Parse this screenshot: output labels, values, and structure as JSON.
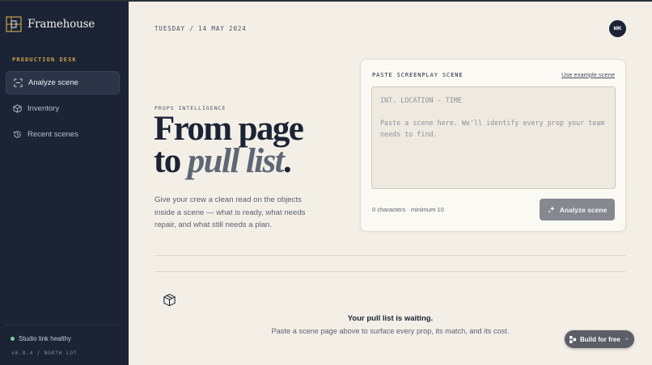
{
  "app": {
    "name": "Framehouse"
  },
  "sidebar": {
    "section_label": "PRODUCTION DESK",
    "items": [
      {
        "label": "Analyze scene",
        "icon": "scan-icon",
        "active": true
      },
      {
        "label": "Inventory",
        "icon": "box-icon",
        "active": false
      },
      {
        "label": "Recent scenes",
        "icon": "history-icon",
        "active": false
      }
    ],
    "status": "Studio link healthy",
    "version": "v0.8.4 / NORTH LOT"
  },
  "header": {
    "date": "TUESDAY / 14 MAY 2024",
    "avatar_initials": "MK"
  },
  "hero": {
    "eyebrow": "PROPS INTELLIGENCE",
    "headline_line1": "From page",
    "headline_to": "to",
    "headline_italic": "pull list",
    "headline_period": ".",
    "description": "Give your crew a clean read on the objects inside a scene — what is ready, what needs repair, and what still needs a plan."
  },
  "card": {
    "title": "PASTE SCREENPLAY SCENE",
    "example_link": "Use example scene",
    "textarea_value": "",
    "textarea_placeholder": "INT. LOCATION - TIME\n\nPaste a scene here. We'll identify every prop your team needs to find.",
    "char_count": "0 characters · minimum 10",
    "analyze_label": "Analyze scene"
  },
  "empty_state": {
    "title": "Your pull list is waiting.",
    "subtitle": "Paste a scene page above to surface every prop, its match, and its cost."
  },
  "build_pill": {
    "label": "Build for free",
    "close": "×"
  },
  "colors": {
    "sidebar_bg": "#1b2335",
    "page_bg": "#f3efe7",
    "accent_gold": "#c9a24a",
    "status_green": "#7fd19b",
    "button_disabled": "#85888f"
  }
}
